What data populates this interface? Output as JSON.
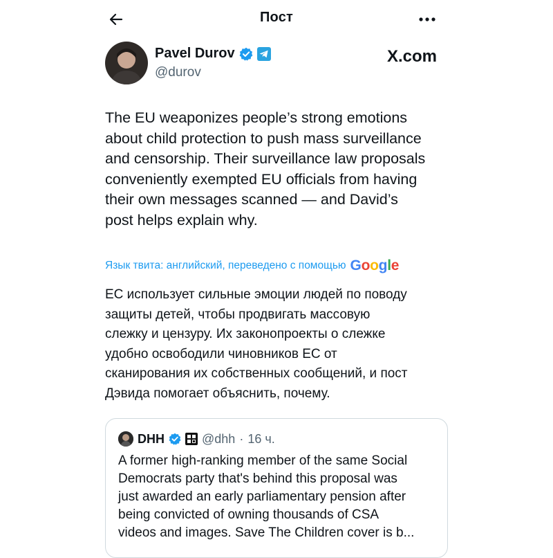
{
  "topbar": {
    "title": "Пост",
    "back_icon": "arrow-left-icon",
    "more_icon": "more-horizontal-icon"
  },
  "post": {
    "author_name": "Pavel Durov",
    "author_handle": "@durov",
    "site": "X.com",
    "text": "The EU weaponizes people’s strong emotions\nabout child protection to push mass surveillance\nand censorship. Their surveillance law proposals\nconveniently exempted EU officials from having\ntheir own messages scanned — and David’s\npost helps explain why.",
    "translate_label": "Язык твита: английский, переведено с помощью",
    "translate_brand": "Google",
    "translated_text": "ЕС использует сильные эмоции людей по поводу\nзащиты детей, чтобы продвигать массовую\nслежку и цензуру. Их законопроекты о слежке\nудобно освободили чиновников ЕС от\nсканирования их собственных сообщений, и пост\nДэвида помогает объяснить, почему."
  },
  "quote": {
    "name": "DHH",
    "handle": "@dhh",
    "separator": "·",
    "time": "16 ч.",
    "text": "A former high-ranking member of the same Social\nDemocrats party that's behind this proposal was\njust awarded an early parliamentary pension after\nbeing convicted of owning thousands of CSA\nvideos and images. Save The Children cover is b..."
  },
  "colors": {
    "accent": "#1d9bf0",
    "text": "#0f1419",
    "muted": "#536471",
    "verified": "#1d9bf0",
    "telegram": "#2aa3e0"
  }
}
